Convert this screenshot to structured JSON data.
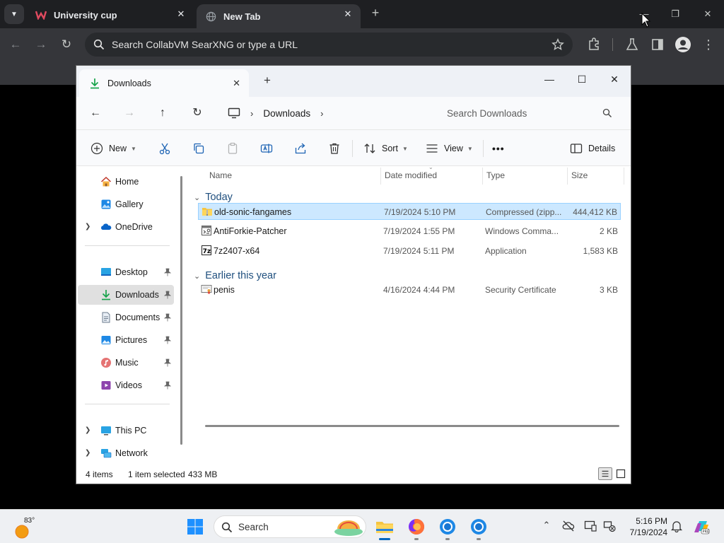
{
  "browser": {
    "tabs": [
      {
        "title": "University cup",
        "active": false
      },
      {
        "title": "New Tab",
        "active": true
      }
    ],
    "omnibox_placeholder": "Search CollabVM SearXNG or type a URL"
  },
  "explorer": {
    "tab_title": "Downloads",
    "breadcrumb": [
      "Downloads"
    ],
    "search_placeholder": "Search Downloads",
    "commands": {
      "new": "New",
      "sort": "Sort",
      "view": "View",
      "details": "Details",
      "more": "•••"
    },
    "nav": {
      "home": "Home",
      "gallery": "Gallery",
      "onedrive": "OneDrive",
      "desktop": "Desktop",
      "downloads": "Downloads",
      "documents": "Documents",
      "pictures": "Pictures",
      "music": "Music",
      "videos": "Videos",
      "this_pc": "This PC",
      "network": "Network"
    },
    "columns": {
      "name": "Name",
      "date": "Date modified",
      "type": "Type",
      "size": "Size"
    },
    "groups": {
      "today": {
        "label": "Today",
        "files": [
          {
            "name": "old-sonic-fangames",
            "date": "7/19/2024 5:10 PM",
            "type": "Compressed (zipp...",
            "size": "444,412 KB",
            "icon": "zip-folder-icon",
            "selected": true
          },
          {
            "name": "AntiForkie-Patcher",
            "date": "7/19/2024 1:55 PM",
            "type": "Windows Comma...",
            "size": "2 KB",
            "icon": "cmd-script-icon",
            "selected": false
          },
          {
            "name": "7z2407-x64",
            "date": "7/19/2024 5:11 PM",
            "type": "Application",
            "size": "1,583 KB",
            "icon": "7zip-icon",
            "selected": false
          }
        ]
      },
      "earlier": {
        "label": "Earlier this year",
        "files": [
          {
            "name": "penis",
            "date": "4/16/2024 4:44 PM",
            "type": "Security Certificate",
            "size": "3 KB",
            "icon": "certificate-icon",
            "selected": false
          }
        ]
      }
    },
    "status": {
      "items": "4 items",
      "selected": "1 item selected",
      "size": "433 MB"
    }
  },
  "taskbar": {
    "weather_temp": "83°",
    "search_label": "Search",
    "time": "5:16 PM",
    "date": "7/19/2024"
  },
  "colors": {
    "accent": "#0067c0",
    "selection_bg": "#cce8ff",
    "group_header": "#1f4f7e"
  }
}
